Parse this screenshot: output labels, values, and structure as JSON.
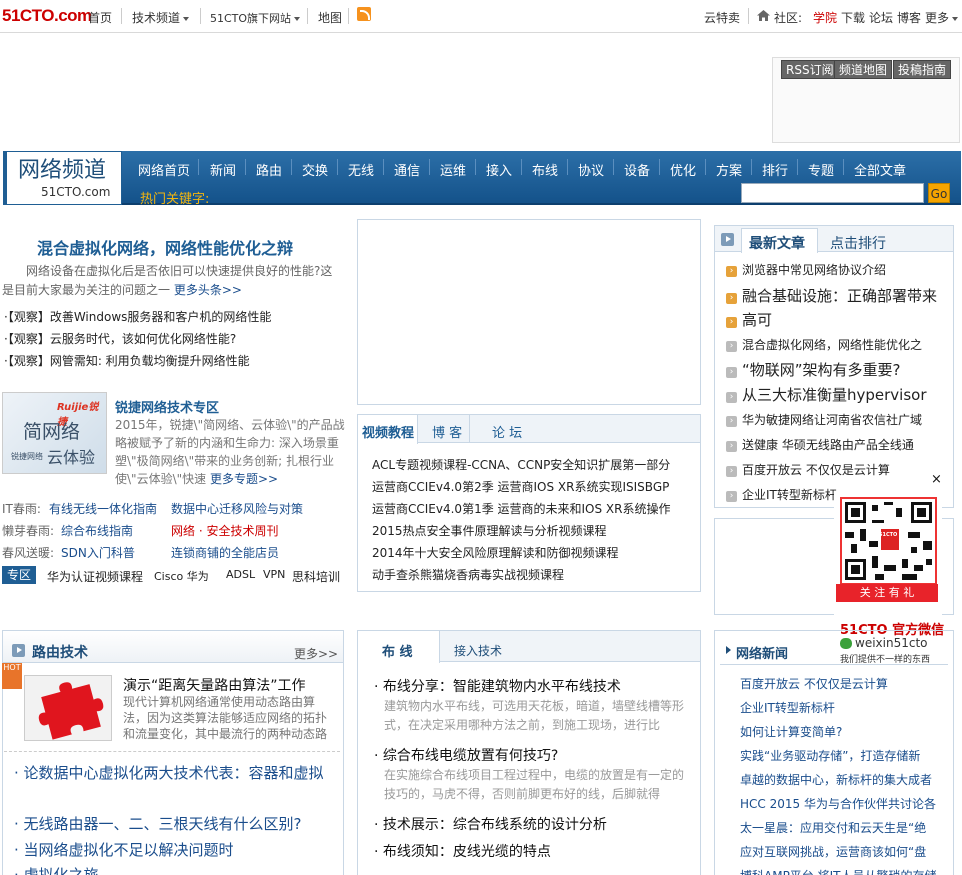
{
  "topbar": {
    "logo": "51CTO.com",
    "nav": [
      "首页",
      "技术频道",
      "51CTO旗下网站",
      "地图"
    ],
    "right_items": [
      "云特卖",
      "社区:",
      "学院",
      "下载",
      "论坛",
      "博客",
      "更多"
    ]
  },
  "header_buttons": [
    "RSS订阅",
    "频道地图",
    "投稿指南"
  ],
  "channel": {
    "title": "网络频道",
    "subtitle": "51CTO.com",
    "nav": [
      "网络首页",
      "新闻",
      "路由",
      "交换",
      "无线",
      "通信",
      "运维",
      "接入",
      "布线",
      "协议",
      "设备",
      "优化",
      "方案",
      "排行",
      "专题",
      "全部文章"
    ],
    "hot_keywords_label": "热门关键字:",
    "search_placeholder": "",
    "go_label": "Go"
  },
  "headline": {
    "title": "混合虚拟化网络，网络性能优化之辩",
    "desc": "网络设备在虚拟化后是否依旧可以快速提供良好的性能?这是目前大家最为关注的问题之一",
    "more": "更多头条>>",
    "bullets": [
      "·【观察】改善Windows服务器和客户机的网络性能",
      "·【观察】云服务时代，该如何优化网络性能?",
      "·【观察】网管需知: 利用负载均衡提升网络性能"
    ]
  },
  "ruijie": {
    "title": "锐捷网络技术专区",
    "desc": "2015年，锐捷\\\"简网络、云体验\\\"的产品战略被赋予了新的内涵和生命力: 深入场景重塑\\\"极简网络\\\"带来的业务创新; 扎根行业使\\\"云体验\\\"快速",
    "more": "更多专题>>",
    "img_brand": "Ruijie锐捷",
    "img_text1": "简网络",
    "img_text2": "云体验",
    "img_caption": "锐捷网络"
  },
  "spring_links": [
    {
      "label": "IT春雨:",
      "a": "有线无线一体化指南",
      "b": "数据中心迁移风险与对策"
    },
    {
      "label": "懒芽春雨:",
      "a": "综合布线指南",
      "b": "网络 · 安全技术周刊"
    },
    {
      "label": "春风送暖:",
      "a": "SDN入门科普",
      "b": "连锁商铺的全能店员"
    }
  ],
  "zhuanqu": {
    "tag": "专区",
    "items": [
      "华为认证视频课程",
      "Cisco 华为",
      "ADSL",
      "VPN",
      "思科培训"
    ]
  },
  "video_tabs": {
    "tabs": [
      "视频教程",
      "博 客",
      "论 坛"
    ],
    "items": [
      "ACL专题视频课程-CCNA、CCNP安全知识扩展第一部分",
      "运营商CCIEv4.0第2季 运营商IOS XR系统实现ISISBGP",
      "运营商CCIEv4.0第1季 运营商的未来和IOS XR系统操作",
      "2015热点安全事件原理解读与分析视频课程",
      "2014年十大安全风险原理解读和防御视频课程",
      "动手查杀熊猫烧香病毒实战视频课程"
    ]
  },
  "latest": {
    "tabs": [
      "最新文章",
      "点击排行"
    ],
    "items": [
      "浏览器中常见网络协议介绍",
      "融合基础设施：正确部署带来",
      "高可",
      "混合虚拟化网络，网络性能优化之",
      "“物联网”架构有多重要?",
      "从三大标准衡量hypervisor",
      "华为敏捷网络让河南省农信社广域",
      "送健康 华硕无线路由产品全线通",
      "百度开放云 不仅仅是云计算",
      "企业IT转型新标杆"
    ]
  },
  "qr": {
    "close": "×",
    "button": "关 注 有 礼",
    "brand": "51CTO 官方微信",
    "wechat": "weixin51cto",
    "tagline": "我们提供不一样的东西",
    "badge": "51CTO"
  },
  "routing": {
    "title": "路由技术",
    "more": "更多>>",
    "hot_badge": "HOT",
    "feature_title": "演示“距离矢量路由算法”工作",
    "feature_desc": "现代计算机网络通常使用动态路由算法，因为这类算法能够适应网络的拓扑和流量变化，其中最流行的两种动态路",
    "items": [
      "· 论数据中心虚拟化两大技术代表：容器和虚拟",
      "· 无线路由器一、二、三根天线有什么区别?",
      "· 当网络虚拟化不足以解决问题时",
      "· 虚拟化之旅"
    ]
  },
  "cabling": {
    "tabs": [
      "布 线",
      "接入技术"
    ],
    "articles": [
      {
        "title": "· 布线分享：智能建筑物内水平布线技术",
        "desc": "建筑物内水平布线，可选用天花板，暗道，墙壁线槽等形式，在决定采用哪种方法之前，到施工现场，进行比"
      },
      {
        "title": "· 综合布线电缆放置有何技巧?",
        "desc": "在实施综合布线项目工程过程中，电缆的放置是有一定的技巧的，马虎不得，否则前脚更布好的线，后脚就得"
      },
      {
        "title": "· 技术展示：综合布线系统的设计分析",
        "desc": ""
      },
      {
        "title": "· 布线须知：皮线光缆的特点",
        "desc": ""
      }
    ]
  },
  "network_news": {
    "title": "网络新闻",
    "items": [
      "百度开放云 不仅仅是云计算",
      "企业IT转型新标杆",
      "如何让计算变简单?",
      "实践“业务驱动存储”，打造存储新",
      "卓越的数据中心，新标杆的集大成者",
      "HCC 2015 华为与合作伙伴共讨论各",
      "太一星晨：应用交付和云天生是“绝",
      "应对互联网挑战，运营商该如何“盘",
      "博科AMP平台 将IT人员从繁琐的存储"
    ]
  }
}
